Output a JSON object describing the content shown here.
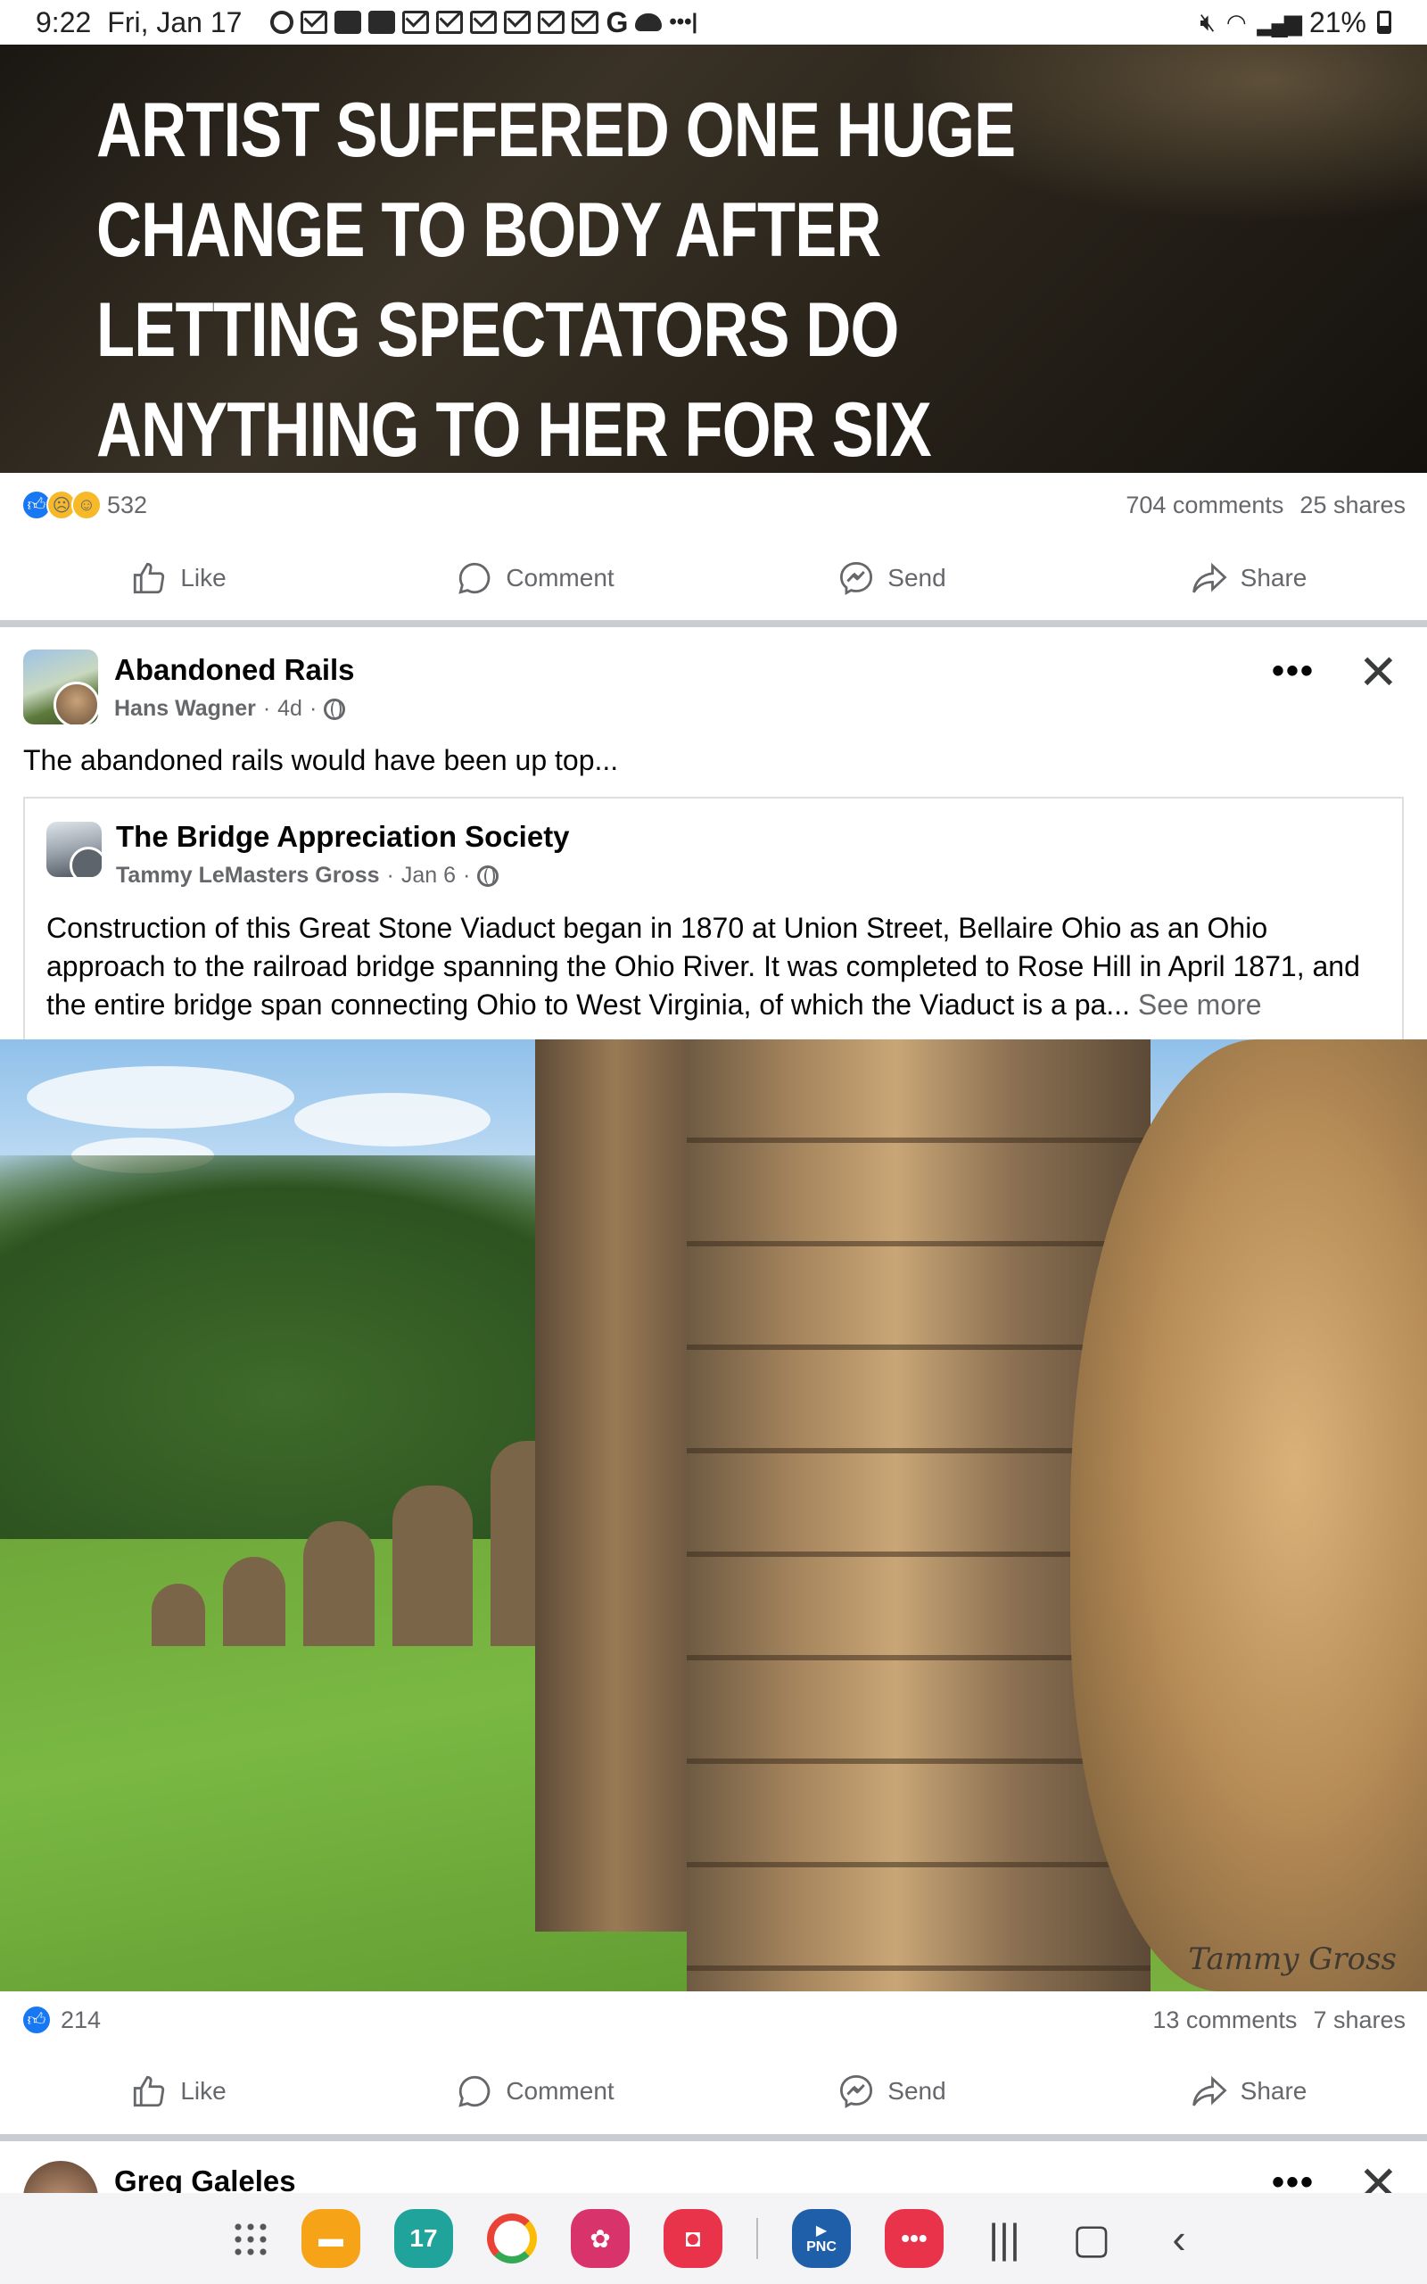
{
  "status_bar": {
    "time": "9:22",
    "date": "Fri, Jan 17",
    "battery": "21%"
  },
  "post1": {
    "headline": "ARTIST SUFFERED ONE HUGE CHANGE TO BODY AFTER LETTING SPECTATORS DO ANYTHING TO HER FOR SIX HOURS",
    "reaction_count": "532",
    "comments": "704 comments",
    "shares": "25 shares"
  },
  "actions": {
    "like": "Like",
    "comment": "Comment",
    "send": "Send",
    "share": "Share"
  },
  "post2": {
    "group_name": "Abandoned Rails",
    "author": "Hans Wagner",
    "time": "4d",
    "text": "The abandoned rails would have been up top...",
    "shared": {
      "page_name": "The Bridge Appreciation Society",
      "author": "Tammy LeMasters Gross",
      "time": "Jan 6",
      "text": "Construction of this Great Stone Viaduct began in 1870 at Union Street, Bellaire Ohio as an Ohio approach to the railroad bridge spanning the Ohio River. It was completed to Rose Hill in April 1871, and the entire bridge span connecting Ohio to West Virginia, of which the Viaduct is a pa...",
      "see_more": "See more"
    },
    "photo_watermark": "Tammy Gross",
    "reaction_count": "214",
    "comments": "13 comments",
    "shares": "7 shares"
  },
  "post3": {
    "name": "Greg Galeles"
  },
  "nav": {
    "calendar_day": "17",
    "pnc": "PNC"
  },
  "icons": {
    "like": "thumbs-up-icon",
    "comment": "speech-bubble-icon",
    "send": "messenger-icon",
    "share": "share-arrow-icon",
    "more": "more-dots-icon",
    "close": "close-icon",
    "globe": "globe-icon"
  },
  "colors": {
    "facebook_blue": "#1877f2",
    "secondary_text": "#65676b",
    "divider": "#c9ccd1"
  }
}
